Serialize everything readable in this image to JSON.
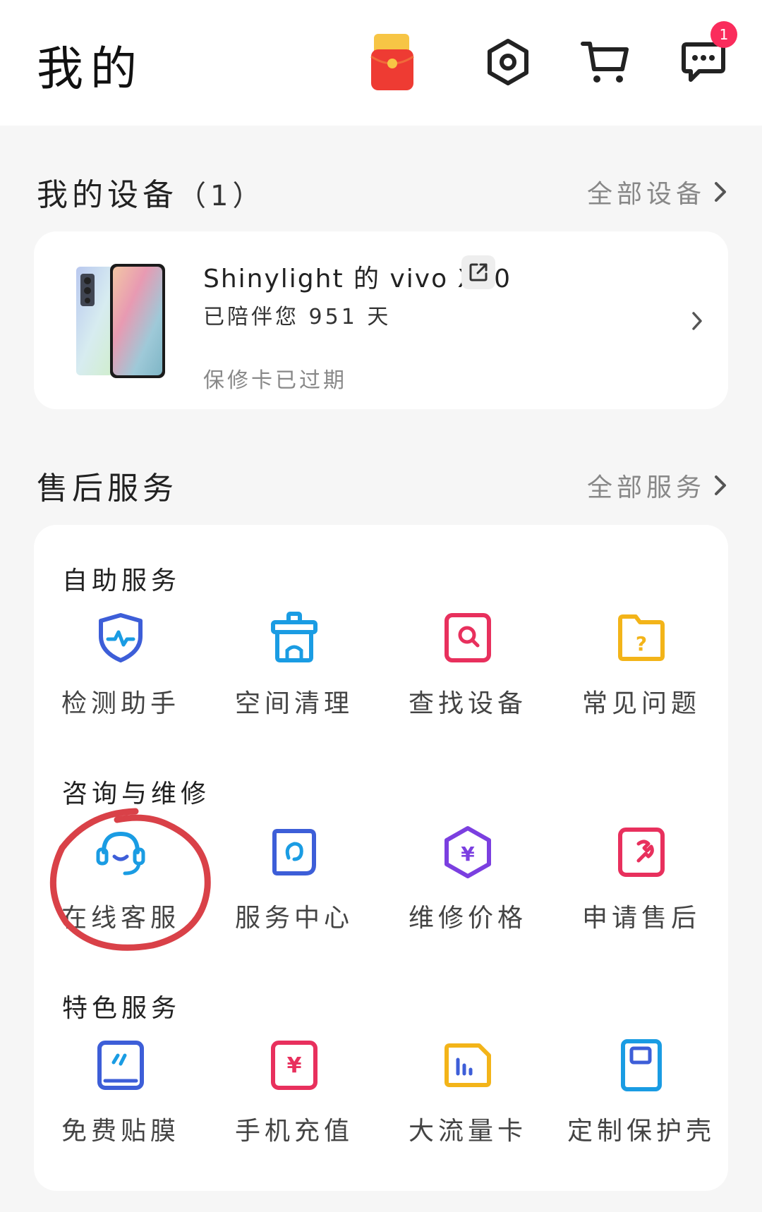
{
  "header": {
    "title": "我的",
    "icons": [
      "red-packet-icon",
      "settings-icon",
      "cart-icon",
      "message-icon"
    ],
    "message_badge": "1"
  },
  "devices": {
    "title": "我的设备",
    "count": "（1）",
    "link": "全部设备",
    "device": {
      "name": "Shinylight 的 vivo X70",
      "days": "已陪伴您 951 天",
      "warranty": "保修卡已过期"
    }
  },
  "services": {
    "title": "售后服务",
    "link": "全部服务",
    "groups": [
      {
        "label": "自助服务",
        "items": [
          {
            "label": "检测助手",
            "icon": "shield-pulse-icon",
            "color": "#3d5ed8"
          },
          {
            "label": "空间清理",
            "icon": "cleanup-icon",
            "color": "#1a9ce3"
          },
          {
            "label": "查找设备",
            "icon": "find-device-icon",
            "color": "#e8305d"
          },
          {
            "label": "常见问题",
            "icon": "faq-folder-icon",
            "color": "#f3b419"
          }
        ]
      },
      {
        "label": "咨询与维修",
        "items": [
          {
            "label": "在线客服",
            "icon": "headset-icon",
            "color": "#1a9ce3"
          },
          {
            "label": "服务中心",
            "icon": "service-center-icon",
            "color": "#3d5ed8"
          },
          {
            "label": "维修价格",
            "icon": "repair-price-icon",
            "color": "#7b3fe0"
          },
          {
            "label": "申请售后",
            "icon": "wrench-icon",
            "color": "#e8305d"
          }
        ]
      },
      {
        "label": "特色服务",
        "items": [
          {
            "label": "免费贴膜",
            "icon": "screen-film-icon",
            "color": "#3d5ed8"
          },
          {
            "label": "手机充值",
            "icon": "recharge-icon",
            "color": "#e8305d"
          },
          {
            "label": "大流量卡",
            "icon": "data-card-icon",
            "color": "#f3b419"
          },
          {
            "label": "定制保护壳",
            "icon": "phone-case-icon",
            "color": "#1a9ce3"
          }
        ]
      }
    ]
  },
  "annotation_color": "#d94148"
}
